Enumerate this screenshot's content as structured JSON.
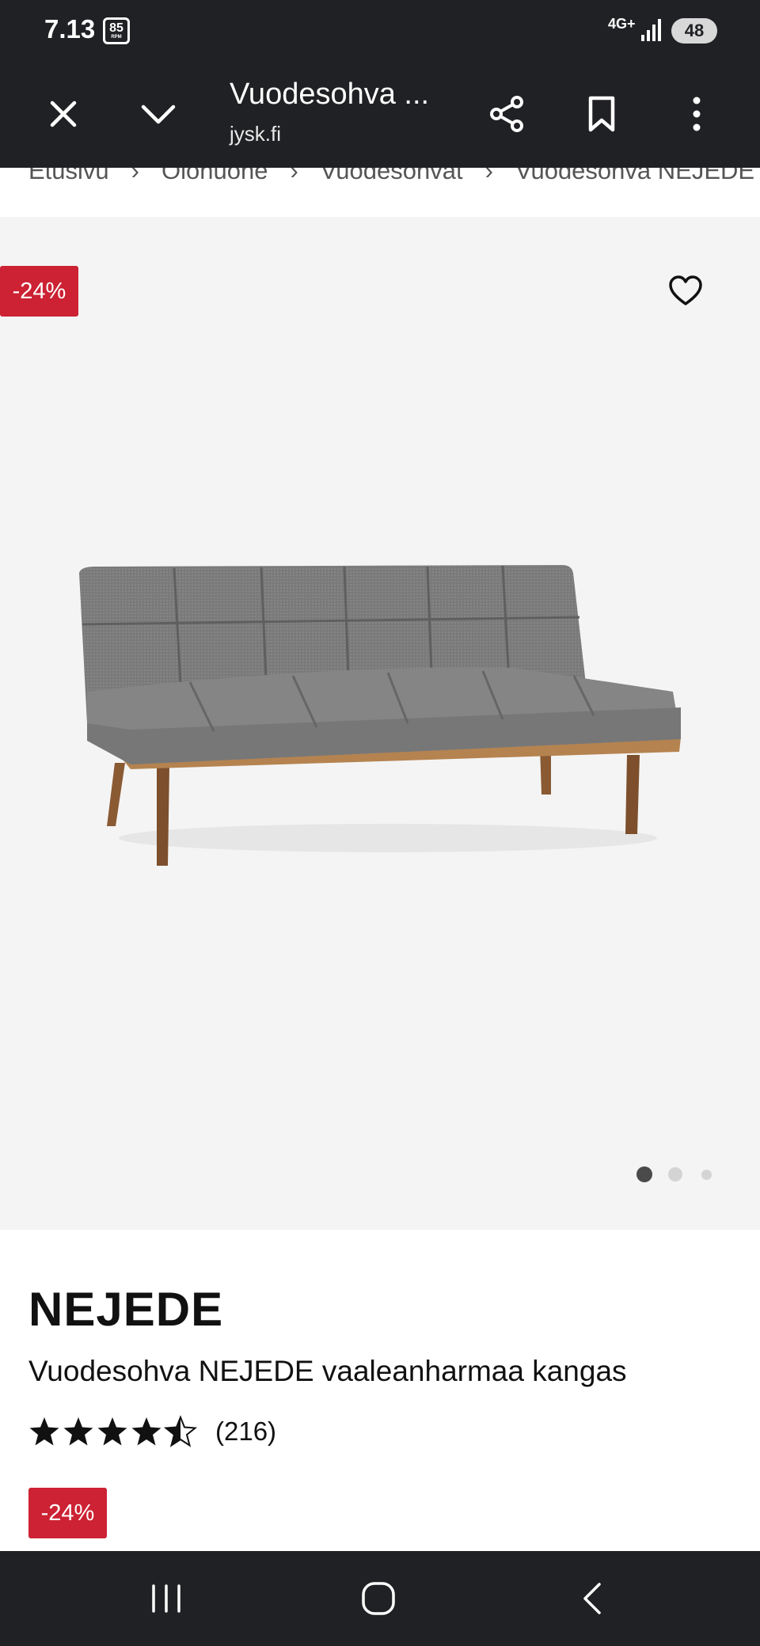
{
  "status_bar": {
    "time": "7.13",
    "badge_value": "85",
    "badge_unit": "RPM",
    "network": "4G+",
    "battery": "48"
  },
  "toolbar": {
    "title": "Vuodesohva ...",
    "domain": "jysk.fi",
    "icons": [
      "close-icon",
      "chevron-down-icon",
      "share-icon",
      "bookmark-icon",
      "more-vert-icon"
    ]
  },
  "breadcrumb": {
    "items": [
      "Etusivu",
      "Olohuone",
      "Vuodesohvat",
      "Vuodesohva NEJEDE"
    ]
  },
  "gallery": {
    "discount": "-24%",
    "current_image": 1,
    "image_count": 3
  },
  "product": {
    "name": "NEJEDE",
    "description": "Vuodesohva NEJEDE vaaleanharmaa kangas",
    "rating": 4.5,
    "review_count": "(216)",
    "discount": "-24%"
  },
  "colors": {
    "chrome": "#202124",
    "discount": "#cc2233",
    "gallery_bg": "#f4f4f4"
  },
  "navigation": {
    "buttons": [
      "recent-apps-icon",
      "home-icon",
      "back-icon"
    ]
  }
}
